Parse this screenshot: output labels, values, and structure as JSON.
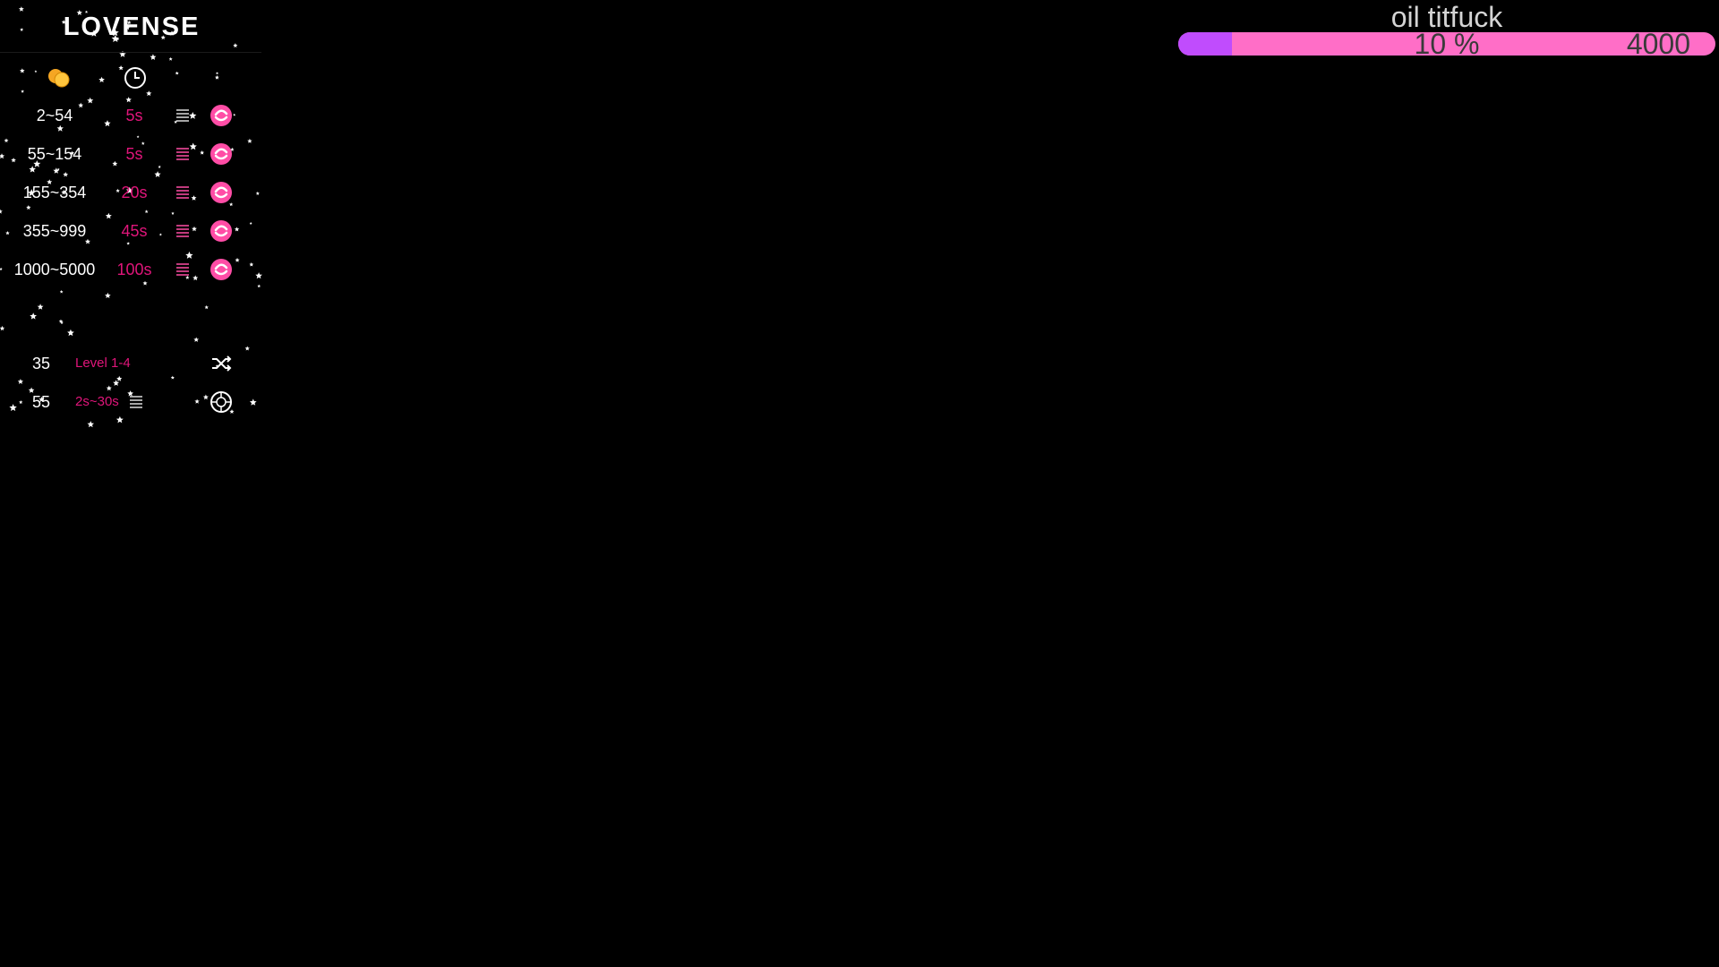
{
  "panel": {
    "logo": "LOVENSE",
    "levels": [
      {
        "range": "2~54",
        "duration": "5s"
      },
      {
        "range": "55~154",
        "duration": "5s"
      },
      {
        "range": "155~354",
        "duration": "20s"
      },
      {
        "range": "355~999",
        "duration": "45s"
      },
      {
        "range": "1000~5000",
        "duration": "100s"
      }
    ],
    "random": {
      "amount": "35",
      "label": "Level 1-4"
    },
    "pattern": {
      "amount": "55",
      "label": "2s~30s"
    },
    "colors": {
      "duration": "#e0157a",
      "icon": "#ff4da6"
    },
    "icons": {
      "tokens": "coins-icon",
      "time": "clock-icon",
      "list": "list-icon",
      "pattern": "wave-pattern-icon",
      "random": "shuffle-icon",
      "special": "dial-pattern-icon"
    }
  },
  "goal": {
    "title": "oil titfuck",
    "percent_label": "10 %",
    "progress": 0.1,
    "amount": "4000",
    "colors": {
      "fill": "#c04cfd",
      "track": "#ff6ec7",
      "text": "#3a3a3a"
    }
  }
}
